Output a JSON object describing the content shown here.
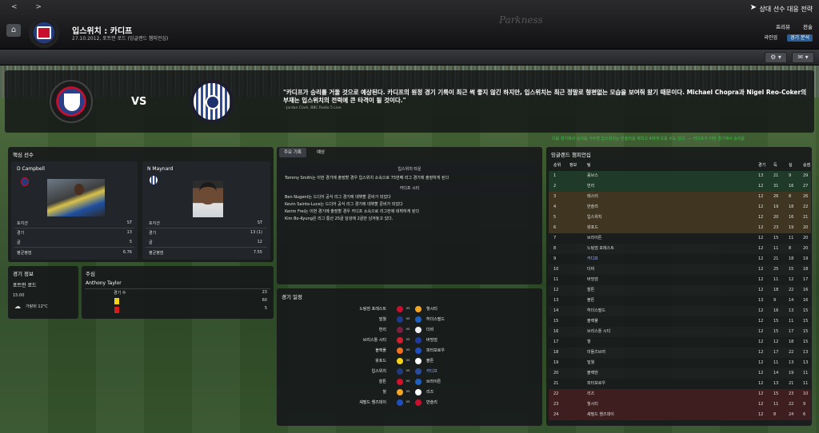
{
  "nav": {
    "back": "<",
    "forward": ">"
  },
  "header": {
    "title": "입스위치 : 카디프",
    "subtitle": "27.10.2012, 포트먼 로드 (잉글랜드 챔피언십)",
    "signature": "Parkness"
  },
  "right_menu": {
    "title": "상대 선수 대응 전략",
    "row1": [
      "프리뷰",
      "전술"
    ],
    "row2": [
      "라인업",
      "경기 분석"
    ]
  },
  "preview": {
    "vs": "VS",
    "quote": "\"카디프가 승리를 거둘 것으로 예상된다. 카디프의 원정 경기 기록이 최근 썩 좋지 않긴 하지만, 입스위치는 최근 정말로 형편없는 모습을 보여줘 왔기 때문이다. Michael Chopra과 Nigel Reo-Coker의 부재는 입스위치의 전력에 큰 타격이 될 것이다.\"",
    "quote_source": "- Jordan Clark, BBC Radio 5 Live",
    "ticker": "다음 경기에서 승리를 거두면 입스위치는 반슬리를 제치고 4위에 오를 수도 있다.   ---   카디프가 이번 경기에서 승리를"
  },
  "key_players": {
    "title": "핵심 선수",
    "players": [
      {
        "name": "D Campbell",
        "pos_label": "포지션",
        "pos": "ST",
        "apps_label": "경기",
        "apps": "13",
        "goals_label": "골",
        "goals": "5",
        "rating_label": "평균평점",
        "rating": "6.76"
      },
      {
        "name": "N Maynard",
        "pos_label": "포지션",
        "pos": "ST",
        "apps_label": "경기",
        "apps": "13 (1)",
        "goals_label": "골",
        "goals": "12",
        "rating_label": "평균평점",
        "rating": "7.55"
      }
    ]
  },
  "match_info": {
    "title": "경기 정보",
    "venue": "포트먼 로드",
    "time": "15:00",
    "weather": "가랑비 12°C"
  },
  "referee": {
    "title": "주심",
    "name": "Anthony Taylor",
    "games_label": "경기 수",
    "games": "23",
    "yellow": "60",
    "red": "5"
  },
  "facts": {
    "tabs": [
      "주요 기록",
      "예상"
    ],
    "home_header": "입스위치 타운",
    "home_lines": [
      "Tommy Smith는 이번 경기에 출장할 경우 입스위치 소속으로 75번째 리그 경기에 출장하게 된다"
    ],
    "away_header": "카디프 시티",
    "away_lines": [
      "Ben Nugent는 드디어 공식 리그 경기에 데뷔할 준비가 되었다",
      "Kevin Sainte-Luce는 드디어 공식 리그 경기에 데뷔할 준비가 되었다",
      "Kerim Frei는 이번 경기에 출장할 경우 카디프 소속으로 리그전에 데뷔하게 된다",
      "Kim Bo-Kyung은 리그 통산 25골 달성에 2골만 남겨놓고 있다."
    ]
  },
  "fixtures": {
    "title": "경기 일정",
    "vs": "vs",
    "list": [
      {
        "home": "노팅엄 포레스트",
        "away": "헐시티",
        "hc": "#c8102e",
        "ac": "#f5a623"
      },
      {
        "home": "밀월",
        "away": "허더스필드",
        "hc": "#1f3b8c",
        "ac": "#1f5fbf"
      },
      {
        "home": "번리",
        "away": "더비",
        "hc": "#7a1f3d",
        "ac": "#eeeeee"
      },
      {
        "home": "브리스톨 시티",
        "away": "버밍엄",
        "hc": "#d21f2f",
        "ac": "#1f3b9c"
      },
      {
        "home": "블랙풀",
        "away": "피터보로우",
        "hc": "#f26f21",
        "ac": "#1f4fbf"
      },
      {
        "home": "왓포드",
        "away": "볼튼",
        "hc": "#f7d117",
        "ac": "#ffffff"
      },
      {
        "home": "입스위치",
        "away": "카디프",
        "hc": "#233a7c",
        "ac": "#2a4b9a",
        "highlight": true
      },
      {
        "home": "찰튼",
        "away": "브라이튼",
        "hc": "#d4102e",
        "ac": "#1f5fbf"
      },
      {
        "home": "헐",
        "away": "리즈",
        "hc": "#f5a623",
        "ac": "#ffffff"
      },
      {
        "home": "셰필드 웬즈데이",
        "away": "반슬리",
        "hc": "#1f4fbf",
        "ac": "#c8102e"
      }
    ]
  },
  "league": {
    "title": "잉글랜드 챔피언십",
    "headers": {
      "pos": "순위",
      "info": "정보",
      "team": "팀",
      "p": "경기",
      "w": "득",
      "d": "실",
      "pts": "승점"
    },
    "rows": [
      {
        "pos": "1",
        "team": "홀브스",
        "p": "13",
        "w": "21",
        "d": "9",
        "pts": "29",
        "zone": "promo"
      },
      {
        "pos": "2",
        "team": "번리",
        "p": "12",
        "w": "31",
        "d": "16",
        "pts": "27",
        "zone": "promo"
      },
      {
        "pos": "3",
        "team": "레스터",
        "p": "12",
        "w": "26",
        "d": "8",
        "pts": "26",
        "zone": "playoff"
      },
      {
        "pos": "4",
        "team": "반슬리",
        "p": "12",
        "w": "19",
        "d": "18",
        "pts": "22",
        "zone": "playoff"
      },
      {
        "pos": "5",
        "team": "입스위치",
        "p": "12",
        "w": "20",
        "d": "16",
        "pts": "21",
        "zone": "playoff"
      },
      {
        "pos": "6",
        "team": "왓포드",
        "p": "12",
        "w": "23",
        "d": "19",
        "pts": "20",
        "zone": "playoff"
      },
      {
        "pos": "7",
        "team": "브라이튼",
        "p": "12",
        "w": "15",
        "d": "11",
        "pts": "20"
      },
      {
        "pos": "8",
        "team": "노팅엄 포레스트",
        "p": "12",
        "w": "11",
        "d": "8",
        "pts": "20"
      },
      {
        "pos": "9",
        "team": "카디프",
        "p": "12",
        "w": "21",
        "d": "18",
        "pts": "19",
        "highlight": true
      },
      {
        "pos": "10",
        "team": "더비",
        "p": "12",
        "w": "25",
        "d": "15",
        "pts": "18"
      },
      {
        "pos": "11",
        "team": "버밍엄",
        "p": "12",
        "w": "11",
        "d": "12",
        "pts": "17"
      },
      {
        "pos": "12",
        "team": "찰튼",
        "p": "12",
        "w": "18",
        "d": "22",
        "pts": "16"
      },
      {
        "pos": "13",
        "team": "볼튼",
        "p": "13",
        "w": "9",
        "d": "14",
        "pts": "16"
      },
      {
        "pos": "14",
        "team": "허더스필드",
        "p": "12",
        "w": "16",
        "d": "13",
        "pts": "15"
      },
      {
        "pos": "15",
        "team": "블랙풀",
        "p": "12",
        "w": "15",
        "d": "11",
        "pts": "15"
      },
      {
        "pos": "16",
        "team": "브리스톨 시티",
        "p": "12",
        "w": "15",
        "d": "17",
        "pts": "15"
      },
      {
        "pos": "17",
        "team": "헐",
        "p": "12",
        "w": "12",
        "d": "18",
        "pts": "15"
      },
      {
        "pos": "18",
        "team": "미들즈브러",
        "p": "12",
        "w": "17",
        "d": "22",
        "pts": "13"
      },
      {
        "pos": "19",
        "team": "밀월",
        "p": "12",
        "w": "11",
        "d": "13",
        "pts": "13"
      },
      {
        "pos": "20",
        "team": "블랙번",
        "p": "12",
        "w": "14",
        "d": "19",
        "pts": "11"
      },
      {
        "pos": "21",
        "team": "피터보로우",
        "p": "12",
        "w": "13",
        "d": "21",
        "pts": "11"
      },
      {
        "pos": "22",
        "team": "리즈",
        "p": "12",
        "w": "15",
        "d": "23",
        "pts": "10",
        "zone": "releg"
      },
      {
        "pos": "23",
        "team": "헐시티",
        "p": "12",
        "w": "11",
        "d": "22",
        "pts": "9",
        "zone": "releg"
      },
      {
        "pos": "24",
        "team": "셰필드 웬즈데이",
        "p": "12",
        "w": "8",
        "d": "24",
        "pts": "6",
        "zone": "releg"
      }
    ]
  },
  "colors": {
    "promo": "#1f3a28",
    "playoff": "#3f3520",
    "releg": "#3e1e1e",
    "panel": "#16181b",
    "accent": "#2b5d96"
  }
}
